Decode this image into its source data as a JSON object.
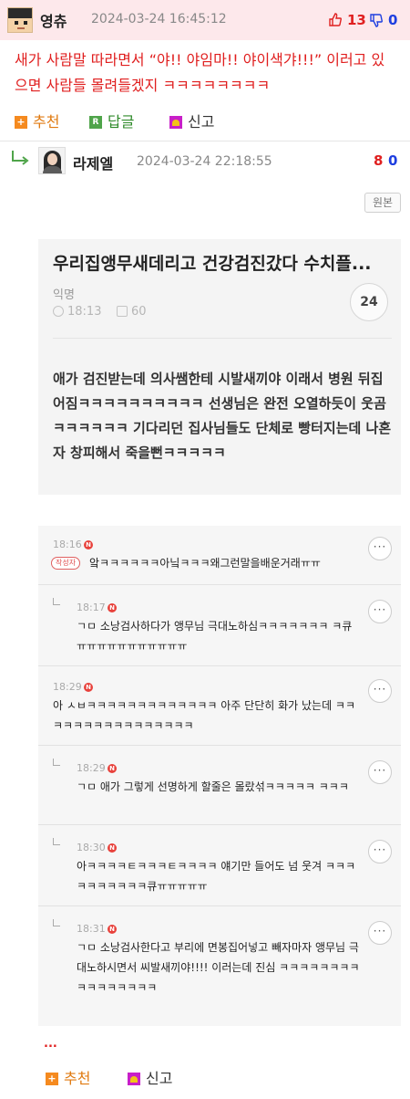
{
  "top_comment": {
    "nickname": "영츄",
    "date": "2024-03-24 16:45:12",
    "upvotes": "13",
    "downvotes": "0",
    "text": "새가 사람말 따라면서 “야!! 야임마!! 야이색갸!!!” 이러고 있으면 사람들 몰려들겠지 ㅋㅋㅋㅋㅋㅋㅋㅋ",
    "actions": {
      "recommend": "추천",
      "reply": "답글",
      "report": "신고"
    }
  },
  "reply_comment": {
    "nickname": "라제엘",
    "date": "2024-03-24 22:18:55",
    "upvotes": "8",
    "downvotes": "0",
    "origin_label": "원본",
    "actions": {
      "recommend": "추천",
      "report": "신고"
    },
    "more_indicator": "..."
  },
  "embedded_post": {
    "title": "우리집앵무새데리고 건강검진갔다 수치플...",
    "author": "익명",
    "time": "18:13",
    "views": "60",
    "comment_count": "24",
    "body": "애가 검진받는데 의사쌤한테 시발새끼야 이래서 병원 뒤집어짐ㅋㅋㅋㅋㅋㅋㅋㅋㅋㅋ 선생님은 완전 오열하듯이 웃곰ㅋㅋㅋㅋㅋㅋ 기다리던 집사님들도 단체로 빵터지는데 나혼자 창피해서 죽을뻔ㅋㅋㅋㅋㅋ",
    "comments": [
      {
        "time": "18:16",
        "writer_tag": "작성자",
        "text": "앜ㅋㅋㅋㅋㅋㅋ아닠ㅋㅋㅋ왜그런말을배운거래ㅠㅠ"
      },
      {
        "time": "18:17",
        "text": "ㄱㅁ 소낭검사하다가 앵무님 극대노하심ㅋㅋㅋㅋㅋㅋㅋ ㅋ큐ㅠㅠㅠㅠㅠㅠㅠㅠㅠㅠㅠ"
      },
      {
        "time": "18:29",
        "text": "아 ㅅㅂㅋㅋㅋㅋㅋㅋㅋㅋㅋㅋㅋㅋㅋ 아주 단단히 화가 났는데 ㅋㅋㅋㅋㅋㅋㅋㅋㅋㅋㅋㅋㅋㅋㅋㅋ"
      },
      {
        "time": "18:29",
        "text": "ㄱㅁ 애가 그렇게 선명하게 할줄은 몰랐섞ㅋㅋㅋㅋㅋ ㅋㅋㅋ"
      },
      {
        "time": "18:30",
        "text": "아ㅋㅋㅋㅋㅌㅋㅋㅋㅌㅋㅋㅋㅋ 얘기만 들어도 넘 웃겨 ㅋㅋㅋㅋㅋㅋㅋㅋㅋㅋ큐ㅠㅠㅠㅠㅠ"
      },
      {
        "time": "18:31",
        "text": "ㄱㅁ 소낭검사한다고 부리에 면봉집어넣고 빼자마자 앵무님 극대노하시면서 씨발새끼야!!!! 이러는데 진심 ㅋㅋㅋㅋㅋㅋㅋㅋㅋㅋㅋㅋㅋㅋㅋㅋ"
      }
    ]
  },
  "colors": {
    "header_bg": "#fde8eb",
    "red": "#e02020",
    "blue": "#1e3fe0"
  }
}
